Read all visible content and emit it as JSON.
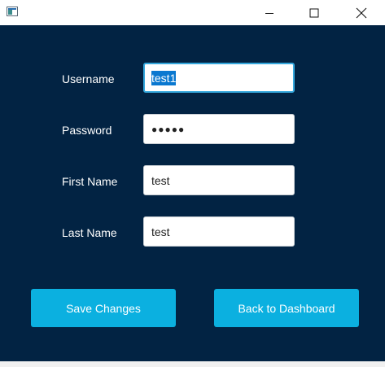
{
  "window": {
    "controls": {
      "minimize_icon": "minimize-icon",
      "maximize_icon": "maximize-icon",
      "close_icon": "close-icon"
    }
  },
  "form": {
    "fields": [
      {
        "label": "Username",
        "value": "test1",
        "state": "focused, text selected"
      },
      {
        "label": "Password",
        "value": "●●●●●",
        "type": "password"
      },
      {
        "label": "First Name",
        "value": "test"
      },
      {
        "label": "Last Name",
        "value": "test"
      }
    ]
  },
  "actions": {
    "save_label": "Save Changes",
    "back_label": "Back to Dashboard"
  },
  "colors": {
    "background": "#022343",
    "button": "#0bb0e0",
    "focus_border": "#35a8dd",
    "selection": "#0a78d0"
  }
}
